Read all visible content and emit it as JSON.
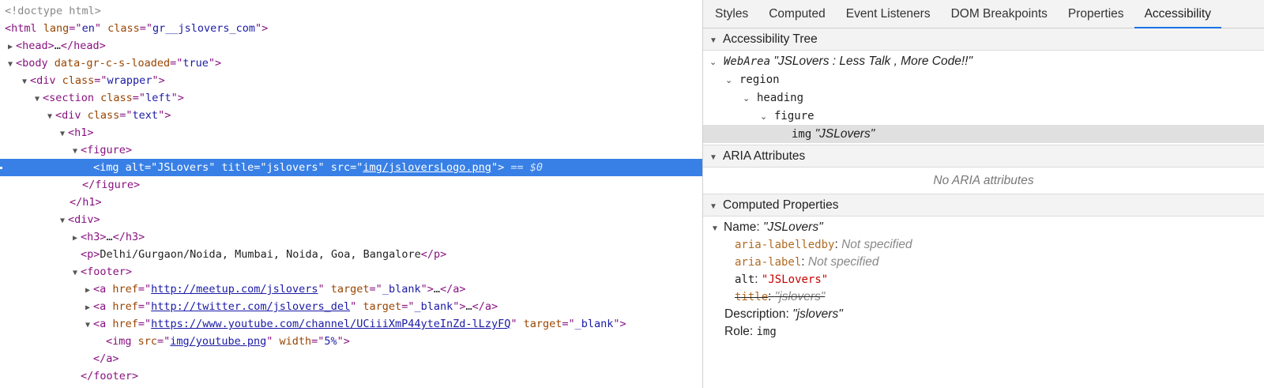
{
  "elements": {
    "doctype": "<!doctype html>",
    "lines": [
      {
        "segments": [
          "<html ",
          "lang",
          "=\"",
          "en",
          "\" ",
          "class",
          "=\"",
          "gr__jslovers_com",
          "\">"
        ]
      },
      {
        "segments": [
          "<head>",
          "…",
          "</head>"
        ]
      },
      {
        "segments": [
          "<body ",
          "data-gr-c-s-loaded",
          "=\"",
          "true",
          "\">"
        ]
      },
      {
        "segments": [
          "<div ",
          "class",
          "=\"",
          "wrapper",
          "\">"
        ]
      },
      {
        "segments": [
          "<section ",
          "class",
          "=\"",
          "left",
          "\">"
        ]
      },
      {
        "segments": [
          "<div ",
          "class",
          "=\"",
          "text",
          "\">"
        ]
      },
      {
        "segments": [
          "<h1>"
        ]
      },
      {
        "segments": [
          "<figure>"
        ]
      },
      {
        "segments": [
          "<img alt=\"JSLovers\" title=\"jslovers\" src=\"",
          "img/jsloversLogo.png",
          "\">",
          "== $0"
        ]
      },
      {
        "segments": [
          "</figure>"
        ]
      },
      {
        "segments": [
          "</h1>"
        ]
      },
      {
        "segments": [
          "<div>"
        ]
      },
      {
        "segments": [
          "<h3>",
          "…",
          "</h3>"
        ]
      },
      {
        "segments": [
          "<p>",
          "Delhi/Gurgaon/Noida, Mumbai, Noida, Goa, Bangalore",
          "</p>"
        ]
      },
      {
        "segments": [
          "<footer>"
        ]
      },
      {
        "segments": [
          "<a ",
          "href",
          "=\"",
          "http://meetup.com/jslovers",
          "\" ",
          "target",
          "=\"",
          "_blank",
          "\">",
          "…",
          "</a>"
        ]
      },
      {
        "segments": [
          "<a ",
          "href",
          "=\"",
          "http://twitter.com/jslovers_del",
          "\" ",
          "target",
          "=\"",
          "_blank",
          "\">",
          "…",
          "</a>"
        ]
      },
      {
        "segments": [
          "<a ",
          "href",
          "=\"",
          "https://www.youtube.com/channel/UCiiiXmP44yteInZd-lLzyFQ",
          "\" ",
          "target",
          "=\"",
          "_blank",
          "\">"
        ]
      },
      {
        "segments": [
          "<img ",
          "src",
          "=\"",
          "img/youtube.png",
          "\" ",
          "width",
          "=\"",
          "5%",
          "\">"
        ]
      },
      {
        "segments": [
          "</a>"
        ]
      },
      {
        "segments": [
          "</footer>"
        ]
      }
    ]
  },
  "sidebar": {
    "tabs": [
      "Styles",
      "Computed",
      "Event Listeners",
      "DOM Breakpoints",
      "Properties",
      "Accessibility"
    ],
    "active_tab": "Accessibility",
    "sections": {
      "tree": "Accessibility Tree",
      "aria": "ARIA Attributes",
      "computed": "Computed Properties"
    },
    "tree": {
      "webarea_role": "WebArea",
      "webarea_name": "\"JSLovers : Less Talk , More Code!!\"",
      "region": "region",
      "heading": "heading",
      "figure": "figure",
      "img_role": "img",
      "img_name": "\"JSLovers\""
    },
    "no_aria": "No ARIA attributes",
    "props": {
      "name_label": "Name:",
      "name_value": "\"JSLovers\"",
      "labelledby_key": "aria-labelledby",
      "label_key": "aria-label",
      "not_specified": "Not specified",
      "alt_key": "alt",
      "alt_value": "\"JSLovers\"",
      "title_key": "title",
      "title_value": "\"jslovers\"",
      "desc_label": "Description:",
      "desc_value": "\"jslovers\"",
      "role_label": "Role:",
      "role_value": "img"
    }
  }
}
